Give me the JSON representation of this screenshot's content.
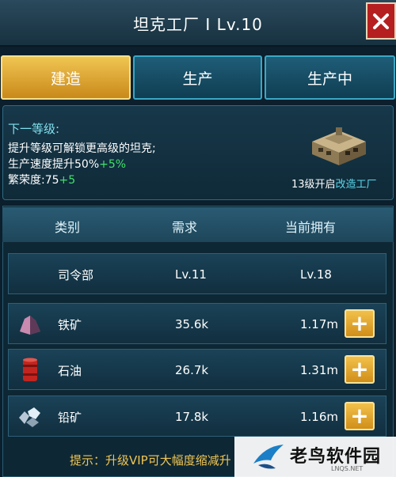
{
  "window": {
    "title": "坦克工厂 I Lv.10"
  },
  "tabs": [
    {
      "label": "建造",
      "active": true
    },
    {
      "label": "生产",
      "active": false
    },
    {
      "label": "生产中",
      "active": false
    }
  ],
  "next_level": {
    "heading": "下一等级:",
    "line1": "提升等级可解锁更高级的坦克;",
    "line2_text": "生产速度提升50%",
    "line2_bonus": "+5%",
    "line3_text": "繁荣度:75",
    "line3_bonus": "+5",
    "unlock_prefix": "13级开启",
    "unlock_link": "改造工厂"
  },
  "table": {
    "headers": [
      "类别",
      "需求",
      "当前拥有"
    ],
    "rows": [
      {
        "name": "司令部",
        "need": "Lv.11",
        "have": "Lv.18",
        "icon": "none",
        "has_add": false
      },
      {
        "name": "铁矿",
        "need": "35.6k",
        "have": "1.17m",
        "icon": "iron-ore-icon",
        "has_add": true
      },
      {
        "name": "石油",
        "need": "26.7k",
        "have": "1.31m",
        "icon": "oil-barrel-icon",
        "has_add": true
      },
      {
        "name": "铅矿",
        "need": "17.8k",
        "have": "1.16m",
        "icon": "lead-ore-icon",
        "has_add": true
      }
    ],
    "add_label": "+"
  },
  "tip": "提示：升级VIP可大幅度缩减升",
  "watermark": {
    "text": "老鸟软件园",
    "sub": "LNQS.NET"
  },
  "colors": {
    "accent_gold": "#f0c552",
    "cyan": "#5ad7ea",
    "green": "#42e06b",
    "close_red": "#b51f1f"
  }
}
